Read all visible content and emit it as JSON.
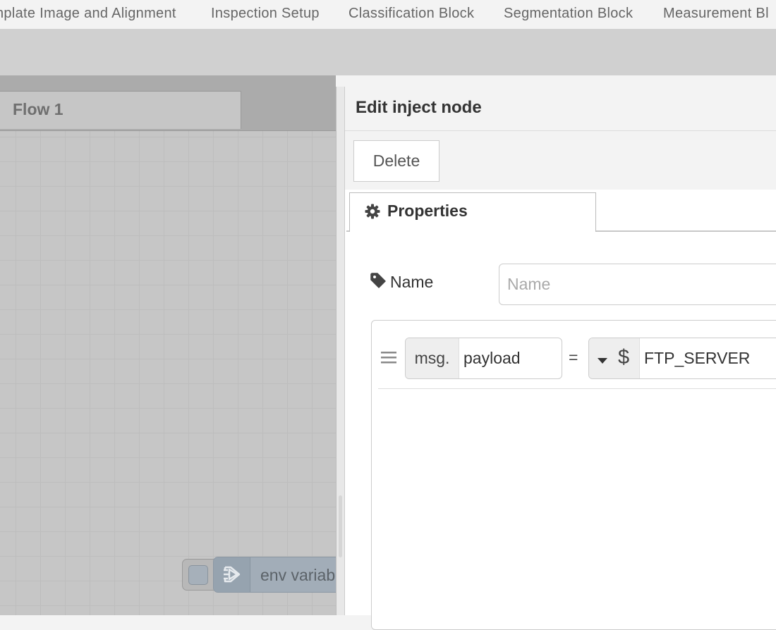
{
  "topnav": {
    "items": [
      {
        "label": "nplate Image and Alignment"
      },
      {
        "label": "Inspection Setup"
      },
      {
        "label": "Classification Block"
      },
      {
        "label": "Segmentation Block"
      },
      {
        "label": "Measurement Bl"
      }
    ]
  },
  "workspace": {
    "flow_tab_label": "Flow 1",
    "node_label": "env variab"
  },
  "tray": {
    "title": "Edit inject node",
    "delete_label": "Delete",
    "tab_label": "Properties",
    "name_label": "Name",
    "name_placeholder": "Name",
    "name_value": "",
    "property": {
      "prefix": "msg.",
      "value": "payload",
      "equals": "=",
      "type_symbol": "$",
      "type_value": "FTP_SERVER"
    }
  },
  "icons": {
    "gear": "gear-icon",
    "tag": "tag-icon",
    "drag": "drag-handle-icon",
    "caret": "caret-down-icon",
    "inject": "inject-arrow-icon"
  },
  "colors": {
    "canvas": "#c6c6c6",
    "node": "#a2adb8",
    "tray_header": "#f3f3f3"
  }
}
